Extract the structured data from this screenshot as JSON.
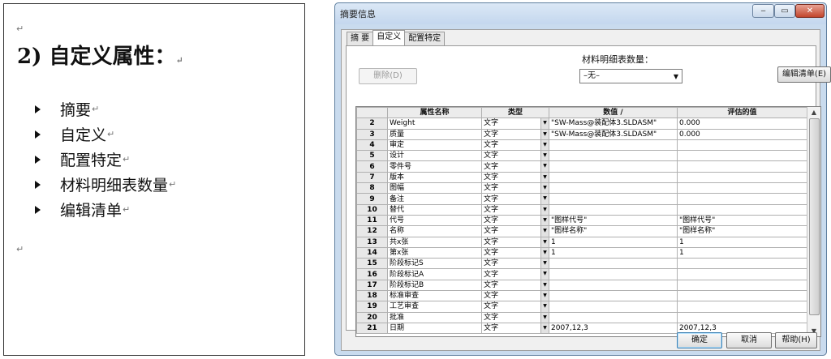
{
  "document": {
    "heading": "2)  自定义属性：",
    "pilcrow": "↵",
    "items": [
      "摘要",
      "自定义",
      "配置特定",
      "材料明细表数量",
      "编辑清单"
    ]
  },
  "dialog": {
    "title": "摘要信息",
    "window_buttons": {
      "minimize": "‒",
      "maximize": "▭",
      "close": "✕"
    },
    "tabs": [
      "摘 要",
      "自定义",
      "配置特定"
    ],
    "active_tab": "自定义",
    "delete_button": "删除(D)",
    "quantity_label": "材料明细表数量：",
    "quantity_value": "–无–",
    "edit_list_button": "编辑清单(E)",
    "grid": {
      "headers": [
        "",
        "属性名称",
        "类型",
        "数值 /",
        "评估的值"
      ],
      "rows": [
        {
          "n": "2",
          "name": "Weight",
          "type": "文字",
          "value": "\"SW-Mass@装配体3.SLDASM\"",
          "evaluated": "0.000"
        },
        {
          "n": "3",
          "name": "质量",
          "type": "文字",
          "value": "\"SW-Mass@装配体3.SLDASM\"",
          "evaluated": "0.000"
        },
        {
          "n": "4",
          "name": "审定",
          "type": "文字",
          "value": "",
          "evaluated": ""
        },
        {
          "n": "5",
          "name": "设计",
          "type": "文字",
          "value": "",
          "evaluated": ""
        },
        {
          "n": "6",
          "name": "零件号",
          "type": "文字",
          "value": "",
          "evaluated": ""
        },
        {
          "n": "7",
          "name": "版本",
          "type": "文字",
          "value": "",
          "evaluated": ""
        },
        {
          "n": "8",
          "name": "图幅",
          "type": "文字",
          "value": "",
          "evaluated": ""
        },
        {
          "n": "9",
          "name": "备注",
          "type": "文字",
          "value": "",
          "evaluated": ""
        },
        {
          "n": "10",
          "name": "替代",
          "type": "文字",
          "value": "",
          "evaluated": ""
        },
        {
          "n": "11",
          "name": "代号",
          "type": "文字",
          "value": "\"图样代号\"",
          "evaluated": "\"图样代号\""
        },
        {
          "n": "12",
          "name": "名称",
          "type": "文字",
          "value": "\"图样名称\"",
          "evaluated": "\"图样名称\""
        },
        {
          "n": "13",
          "name": "共x张",
          "type": "文字",
          "value": "1",
          "evaluated": "1"
        },
        {
          "n": "14",
          "name": "第x张",
          "type": "文字",
          "value": "1",
          "evaluated": "1"
        },
        {
          "n": "15",
          "name": "阶段标记S",
          "type": "文字",
          "value": "",
          "evaluated": ""
        },
        {
          "n": "16",
          "name": "阶段标记A",
          "type": "文字",
          "value": "",
          "evaluated": ""
        },
        {
          "n": "17",
          "name": "阶段标记B",
          "type": "文字",
          "value": "",
          "evaluated": ""
        },
        {
          "n": "18",
          "name": "标准审查",
          "type": "文字",
          "value": "",
          "evaluated": ""
        },
        {
          "n": "19",
          "name": "工艺审查",
          "type": "文字",
          "value": "",
          "evaluated": ""
        },
        {
          "n": "20",
          "name": "批准",
          "type": "文字",
          "value": "",
          "evaluated": ""
        },
        {
          "n": "21",
          "name": "日期",
          "type": "文字",
          "value": "2007,12,3",
          "evaluated": "2007,12,3"
        }
      ]
    },
    "buttons": {
      "ok": "确定",
      "cancel": "取消",
      "help": "帮助(H)"
    }
  }
}
